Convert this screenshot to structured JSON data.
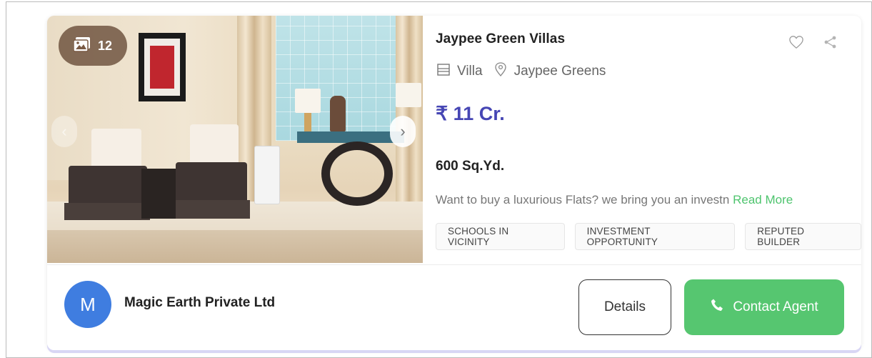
{
  "gallery": {
    "photo_count": "12",
    "icon": "image-gallery-icon"
  },
  "listing": {
    "title": "Jaypee Green Villas",
    "property_type": "Villa",
    "location": "Jaypee Greens",
    "price": "₹ 11 Cr.",
    "area": "600 Sq.Yd.",
    "description": "Want to buy a luxurious Flats? we bring you an investn",
    "read_more": "Read More",
    "tags": [
      "SCHOOLS IN VICINITY",
      "INVESTMENT OPPORTUNITY",
      "REPUTED BUILDER"
    ]
  },
  "agent": {
    "initial": "M",
    "name": "Magic Earth Private Ltd",
    "avatar_color": "#3f7de0"
  },
  "actions": {
    "details_label": "Details",
    "contact_label": "Contact Agent"
  },
  "colors": {
    "price": "#4646b4",
    "accent_green": "#56c670",
    "read_more": "#4ec46e"
  }
}
